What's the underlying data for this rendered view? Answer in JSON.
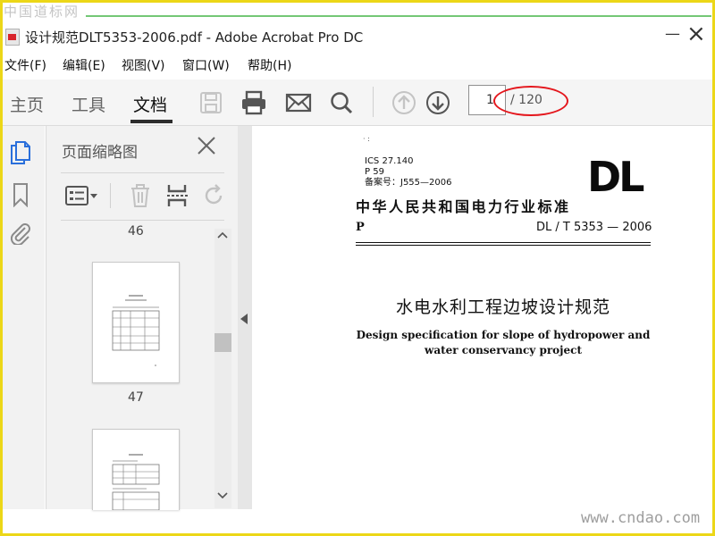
{
  "watermark_top": "中国道标网",
  "watermark_bottom": "www.cndao.com",
  "window": {
    "title": "设计规范DLT5353-2006.pdf - Adobe Acrobat Pro DC",
    "minimize": "—",
    "close": "×"
  },
  "menu": [
    "文件(F)",
    "编辑(E)",
    "视图(V)",
    "窗口(W)",
    "帮助(H)"
  ],
  "toolbar": {
    "tabs": [
      "主页",
      "工具",
      "文档"
    ],
    "active_tab": "文档",
    "icons": [
      "save-icon",
      "print-icon",
      "email-icon",
      "search-icon",
      "page-up-icon",
      "page-down-icon"
    ],
    "page_current": "1",
    "page_total": "/ 120"
  },
  "rail_icons": [
    "page-thumbnails-icon",
    "bookmark-icon",
    "attachment-icon"
  ],
  "panel": {
    "title": "页面缩略图",
    "close": "×",
    "tools": [
      "thumbnail-options-icon",
      "delete-icon",
      "extract-icon",
      "rotate-icon"
    ],
    "thumbnails": [
      {
        "label": "46"
      },
      {
        "label": "47"
      },
      {
        "label": ""
      }
    ]
  },
  "document": {
    "marker": "· :",
    "ics": "ICS 27.140",
    "p59": "P 59",
    "record": "备案号：J555—2006",
    "logo": "DL",
    "std_title": "中华人民共和国电力行业标准",
    "p_label": "P",
    "std_code": "DL / T  5353 — 2006",
    "cn_title": "水电水利工程边坡设计规范",
    "en_title_1": "Design specification for slope of hydropower and",
    "en_title_2": "water conservancy project"
  },
  "colors": {
    "frame": "#ecd718",
    "accent_red": "#e4161c",
    "green_line": "#74c776",
    "rail_active": "#2a6fdb"
  }
}
